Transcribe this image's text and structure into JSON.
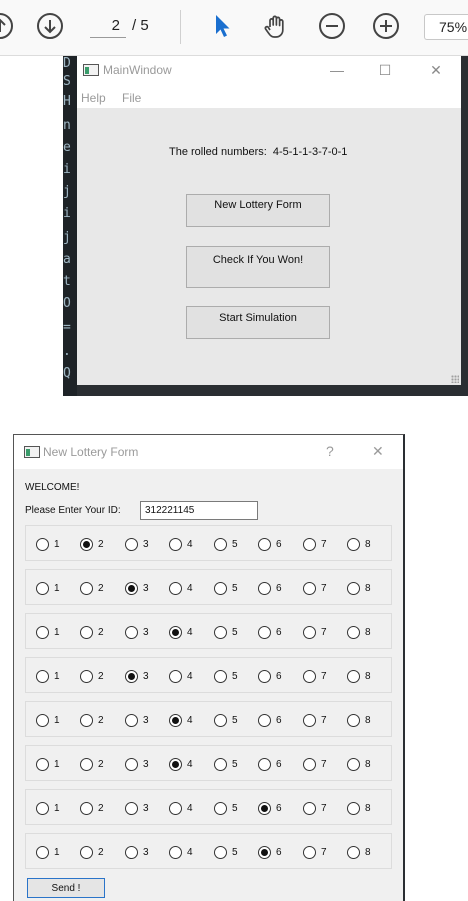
{
  "viewer": {
    "page_current": "2",
    "page_total": "/ 5",
    "zoom": "75%",
    "icons": [
      "page-up-icon",
      "page-down-icon",
      "select-pointer-icon",
      "pan-hand-icon",
      "zoom-out-icon",
      "zoom-in-icon"
    ],
    "accent_color": "#1a6fcf"
  },
  "code_lines": [
    "D",
    "S",
    "H",
    "n",
    "e",
    "i",
    "j",
    "i",
    "j",
    "a",
    "t",
    "O",
    "=",
    ".",
    "Q"
  ],
  "main_window": {
    "title": "MainWindow",
    "controls": [
      "—",
      "☐",
      "✕"
    ],
    "menu": [
      "Help",
      "File"
    ],
    "rolled_label": "The rolled numbers:",
    "rolled_value": "4-5-1-1-3-7-0-1",
    "buttons": [
      "New Lottery Form",
      "Check If You Won!",
      "Start Simulation"
    ]
  },
  "lottery_form": {
    "title": "New Lottery Form",
    "controls": [
      "?",
      "✕"
    ],
    "welcome": "WELCOME!",
    "id_label": "Please Enter Your ID:",
    "id_value": "312221145",
    "options": [
      "1",
      "2",
      "3",
      "4",
      "5",
      "6",
      "7",
      "8"
    ],
    "selected": [
      2,
      3,
      4,
      3,
      4,
      4,
      6,
      6
    ],
    "send_label": "Send !"
  }
}
